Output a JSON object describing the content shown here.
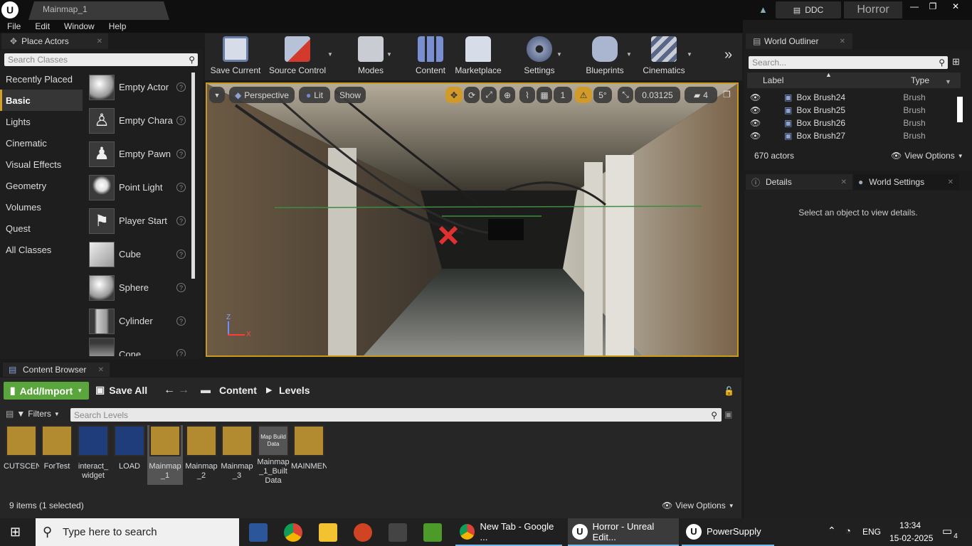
{
  "titlebar": {
    "document_tab": "Mainmap_1",
    "ddc_label": "DDC",
    "project": "Horror"
  },
  "menubar": {
    "items": [
      "File",
      "Edit",
      "Window",
      "Help"
    ]
  },
  "place_actors": {
    "tab": "Place Actors",
    "search_placeholder": "Search Classes",
    "categories": [
      "Recently Placed",
      "Basic",
      "Lights",
      "Cinematic",
      "Visual Effects",
      "Geometry",
      "Volumes",
      "Quest",
      "All Classes"
    ],
    "selected_category": "Basic",
    "actors": [
      "Empty Actor",
      "Empty Chara",
      "Empty Pawn",
      "Point Light",
      "Player Start",
      "Cube",
      "Sphere",
      "Cylinder",
      "Cone"
    ]
  },
  "toolbar": {
    "buttons": [
      "Save Current",
      "Source Control",
      "Modes",
      "Content",
      "Marketplace",
      "Settings",
      "Blueprints",
      "Cinematics"
    ]
  },
  "viewport": {
    "perspective": "Perspective",
    "lit": "Lit",
    "show": "Show",
    "grid_value": "1",
    "angle_value": "5°",
    "scale_value": "0.03125",
    "camera_speed": "4",
    "axis_z": "Z",
    "axis_x": "X"
  },
  "world_outliner": {
    "tab": "World Outliner",
    "search_placeholder": "Search...",
    "col_label": "Label",
    "col_type": "Type",
    "rows": [
      {
        "label": "Box Brush24",
        "type": "Brush"
      },
      {
        "label": "Box Brush25",
        "type": "Brush"
      },
      {
        "label": "Box Brush26",
        "type": "Brush"
      },
      {
        "label": "Box Brush27",
        "type": "Brush"
      }
    ],
    "actor_count": "670 actors",
    "view_options": "View Options"
  },
  "details": {
    "tab": "Details",
    "world_settings_tab": "World Settings",
    "empty_text": "Select an object to view details."
  },
  "content_browser": {
    "tab": "Content Browser",
    "add_import": "Add/Import",
    "save_all": "Save All",
    "path": [
      "Content",
      "Levels"
    ],
    "filters": "Filters",
    "search_placeholder": "Search Levels",
    "assets": [
      {
        "name": "CUTSCENI",
        "kind": "level"
      },
      {
        "name": "ForTest",
        "kind": "level"
      },
      {
        "name": "interact_\nwidget",
        "kind": "widget"
      },
      {
        "name": "LOAD",
        "kind": "widget"
      },
      {
        "name": "Mainmap\n_1",
        "kind": "level",
        "selected": true
      },
      {
        "name": "Mainmap\n_2",
        "kind": "level"
      },
      {
        "name": "Mainmap\n_3",
        "kind": "level"
      },
      {
        "name": "Mainmap\n_1_Built\nData",
        "kind": "data",
        "thumb_label": "Map Build Data"
      },
      {
        "name": "MAINMENU",
        "kind": "level"
      }
    ],
    "status": "9 items (1 selected)",
    "view_options": "View Options"
  },
  "taskbar": {
    "search_placeholder": "Type here to search",
    "apps": [
      {
        "label": "New Tab - Google ...",
        "icon": "chrome-icon"
      },
      {
        "label": "Horror - Unreal Edit...",
        "icon": "unreal-icon",
        "active": true
      },
      {
        "label": "PowerSupply",
        "icon": "unreal-icon"
      }
    ],
    "lang": "ENG",
    "time": "13:34",
    "date": "15-02-2025",
    "notif_count": "4"
  },
  "colors": {
    "accent": "#c59a1f",
    "add_import": "#5aa63c",
    "selection": "#d79f24"
  }
}
